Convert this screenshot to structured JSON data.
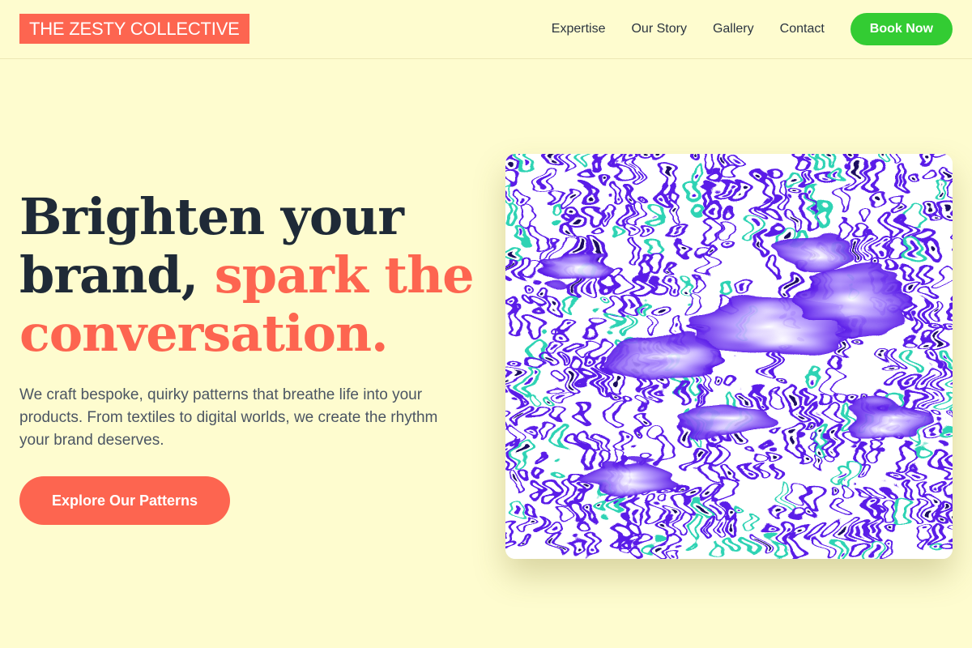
{
  "header": {
    "logo": "THE ZESTY COLLECTIVE",
    "nav": [
      "Expertise",
      "Our Story",
      "Gallery",
      "Contact"
    ],
    "cta": "Book Now"
  },
  "hero": {
    "title_line1": "Brighten your",
    "title_line2_plain": "brand, ",
    "title_line2_accent": "spark the",
    "title_line3_accent": "conversation.",
    "description": "We craft bespoke, quirky patterns that breathe life into your products. From textiles to digital worlds, we create the rhythm your brand deserves.",
    "cta": "Explore Our Patterns"
  },
  "colors": {
    "background": "#fefccf",
    "accent": "#fd6550",
    "book_button": "#33cc33",
    "heading": "#1f2a37",
    "pattern_primary": "#5a1be8",
    "pattern_secondary": "#2fd3b4"
  }
}
